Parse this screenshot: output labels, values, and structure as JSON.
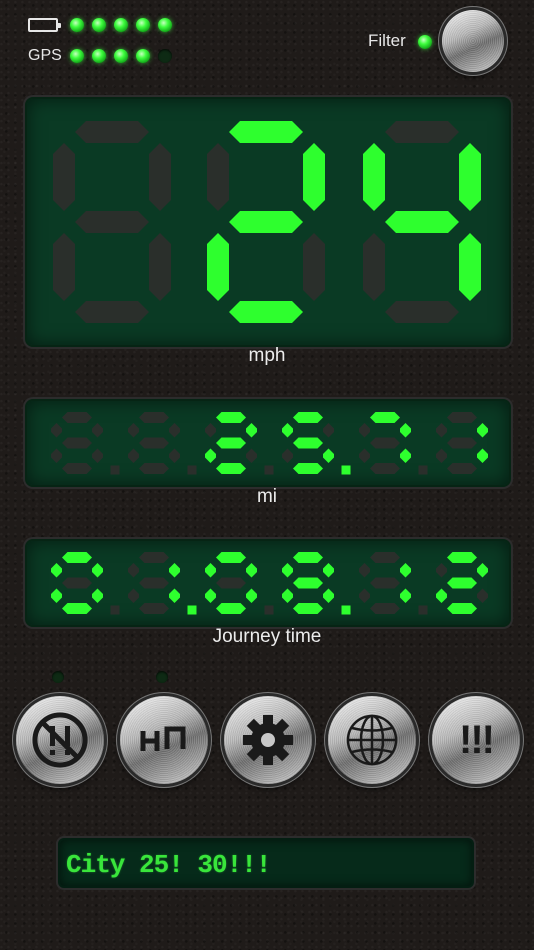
{
  "status": {
    "battery_icon": "battery-icon",
    "gps_label": "GPS",
    "signal_leds": [
      true,
      true,
      true,
      true,
      true
    ],
    "gps_leds": [
      true,
      true,
      true,
      true,
      false
    ],
    "filter_label": "Filter",
    "filter_on": true,
    "filter_button_icon": "metal-knob"
  },
  "speed": {
    "digits": [
      " ",
      "2",
      "4"
    ],
    "unit": "mph"
  },
  "distance": {
    "digits": [
      " ",
      " ",
      "2",
      "5",
      "7",
      "1"
    ],
    "decimal_after": 3,
    "unit": "mi"
  },
  "journey": {
    "digits": [
      "0",
      "1",
      "0",
      "8",
      "1",
      "2"
    ],
    "separators_after": [
      1,
      3
    ],
    "label": "Journey time"
  },
  "controls": {
    "indicator_leds": [
      false,
      false
    ],
    "buttons": [
      {
        "icon": "no-warning-icon"
      },
      {
        "icon": "hud-icon"
      },
      {
        "icon": "gear-icon"
      },
      {
        "icon": "globe-icon"
      },
      {
        "icon": "alerts-icon",
        "label": "!!!"
      }
    ]
  },
  "message": {
    "text": "City 25! 30!!!"
  },
  "colors": {
    "led_green": "#2eff2e",
    "display_bg": "#0a3a24",
    "segment_off": "#2a2f2b"
  }
}
